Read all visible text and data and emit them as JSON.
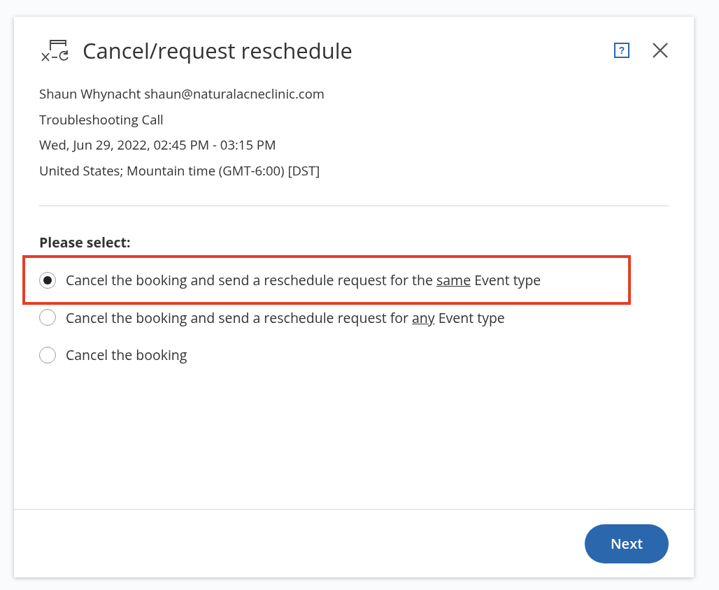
{
  "dialog": {
    "title": "Cancel/request reschedule",
    "help": "?",
    "details": [
      "Shaun Whynacht shaun@naturalacneclinic.com",
      "Troubleshooting Call",
      "Wed, Jun 29, 2022, 02:45 PM - 03:15 PM",
      "United States; Mountain time (GMT-6:00) [DST]"
    ],
    "prompt": "Please select:",
    "options": [
      {
        "before": "Cancel the booking and send a reschedule request for the ",
        "underlined": "same",
        "after": " Event type",
        "selected": true,
        "highlighted": true
      },
      {
        "before": "Cancel the booking and send a reschedule request for ",
        "underlined": "any",
        "after": " Event type",
        "selected": false,
        "highlighted": false
      },
      {
        "before": "Cancel the booking",
        "selected": false,
        "highlighted": false
      }
    ],
    "buttons": [
      "Next"
    ]
  }
}
